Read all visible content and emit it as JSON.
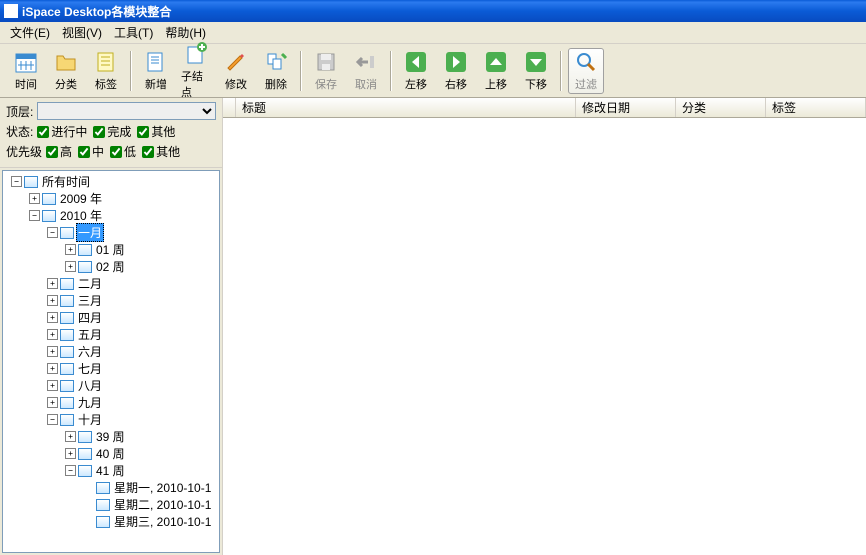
{
  "title": "iSpace Desktop各模块整合",
  "menu": {
    "file": "文件(E)",
    "view": "视图(V)",
    "tool": "工具(T)",
    "help": "帮助(H)"
  },
  "toolbar": {
    "time": "时间",
    "category": "分类",
    "tag": "标签",
    "new": "新增",
    "subnode": "子结点",
    "modify": "修改",
    "delete": "删除",
    "save": "保存",
    "cancel": "取消",
    "moveLeft": "左移",
    "moveRight": "右移",
    "moveUp": "上移",
    "moveDown": "下移",
    "filter": "过滤"
  },
  "filters": {
    "levelLabel": "顶层:",
    "statusLabel": "状态:",
    "priorityLabel": "优先级",
    "status": {
      "inProgress": "进行中",
      "done": "完成",
      "other": "其他"
    },
    "priority": {
      "high": "高",
      "mid": "中",
      "low": "低",
      "other": "其他"
    }
  },
  "tree": {
    "root": "所有时间",
    "y2009": "2009 年",
    "y2010": "2010 年",
    "jan": "一月",
    "w01": "01 周",
    "w02": "02 周",
    "feb": "二月",
    "mar": "三月",
    "apr": "四月",
    "may": "五月",
    "jun": "六月",
    "jul": "七月",
    "aug": "八月",
    "sep": "九月",
    "oct": "十月",
    "w39": "39 周",
    "w40": "40 周",
    "w41": "41 周",
    "day1": "星期一, 2010-10-1",
    "day2": "星期二, 2010-10-1",
    "day3": "星期三, 2010-10-1"
  },
  "listHeaders": {
    "title": "标题",
    "modified": "修改日期",
    "category": "分类",
    "tag": "标签"
  }
}
